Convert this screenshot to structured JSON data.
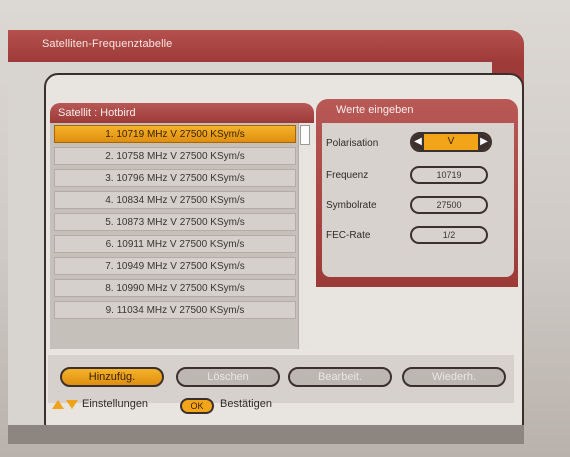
{
  "header": {
    "title": "Satelliten-Frequenztabelle"
  },
  "left_panel": {
    "title": "Satellit : Hotbird",
    "items": [
      "1. 10719 MHz V 27500 KSym/s",
      "2. 10758 MHz V 27500 KSym/s",
      "3. 10796 MHz V 27500 KSym/s",
      "4. 10834 MHz V 27500 KSym/s",
      "5. 10873 MHz V 27500 KSym/s",
      "6. 10911 MHz V 27500 KSym/s",
      "7. 10949 MHz V 27500 KSym/s",
      "8. 10990 MHz V 27500 KSym/s",
      "9. 11034 MHz V 27500 KSym/s"
    ]
  },
  "right_panel": {
    "title": "Werte eingeben",
    "fields": {
      "polarisation_label": "Polarisation",
      "polarisation_value": "V",
      "frequenz_label": "Frequenz",
      "frequenz_value": "10719",
      "symbolrate_label": "Symbolrate",
      "symbolrate_value": "27500",
      "fec_label": "FEC-Rate",
      "fec_value": "1/2"
    }
  },
  "buttons": {
    "hinzufug": "Hinzufüg.",
    "loschen": "Löschen",
    "bearbeiten": "Bearbeit.",
    "wiederh": "Wiederh."
  },
  "hints": {
    "navigation_label": "Einstellungen",
    "ok_label": "OK",
    "confirm_label": "Bestätigen"
  },
  "colors": {
    "accent": "#f3a51a",
    "maroon": "#9e3b39",
    "panel_gray": "#d7d2cd"
  }
}
